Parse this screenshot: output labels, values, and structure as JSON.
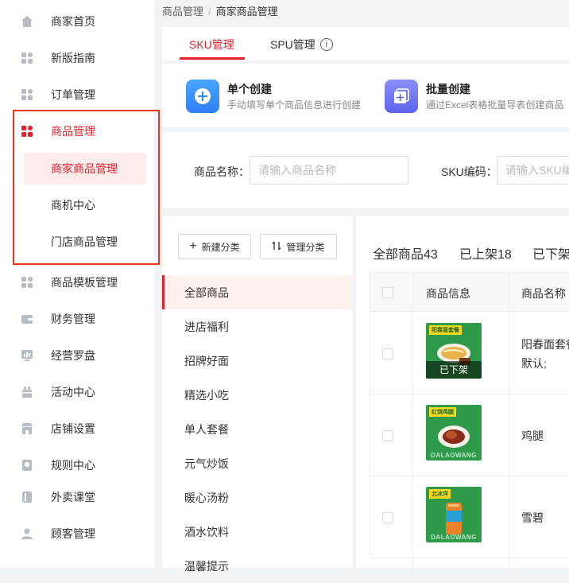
{
  "sidebar": {
    "items": [
      {
        "label": "商家首页",
        "icon": "home-icon"
      },
      {
        "label": "新版指南",
        "icon": "grid-icon"
      },
      {
        "label": "订单管理",
        "icon": "grid-icon"
      },
      {
        "label": "商品管理",
        "icon": "grid-icon",
        "active": true
      },
      {
        "label": "商品模板管理",
        "icon": "grid-icon"
      },
      {
        "label": "财务管理",
        "icon": "wallet-icon"
      },
      {
        "label": "经营罗盘",
        "icon": "chart-icon"
      },
      {
        "label": "活动中心",
        "icon": "gift-icon"
      },
      {
        "label": "店铺设置",
        "icon": "store-icon"
      },
      {
        "label": "规则中心",
        "icon": "rule-icon"
      },
      {
        "label": "外卖课堂",
        "icon": "book-icon"
      },
      {
        "label": "顾客管理",
        "icon": "user-icon"
      }
    ],
    "subitems": [
      {
        "label": "商家商品管理",
        "selected": true
      },
      {
        "label": "商机中心"
      },
      {
        "label": "门店商品管理"
      }
    ]
  },
  "breadcrumb": {
    "parent": "商品管理",
    "separator": "/",
    "current": "商家商品管理"
  },
  "tabs": {
    "sku": "SKU管理",
    "spu": "SPU管理",
    "info": "i"
  },
  "create": {
    "single_title": "单个创建",
    "single_desc": "手动填写单个商品信息进行创建",
    "batch_title": "批量创建",
    "batch_desc": "通过Excel表格批量导表创建商品"
  },
  "filter": {
    "name_label": "商品名称：",
    "name_placeholder": "请输入商品名称",
    "sku_label": "SKU编码：",
    "sku_placeholder": "请输入SKU编码"
  },
  "category": {
    "new_btn": "新建分类",
    "manage_btn": "管理分类",
    "items": [
      "全部商品",
      "进店福利",
      "招牌好面",
      "精选小吃",
      "单人套餐",
      "元气炒饭",
      "暖心汤粉",
      "酒水饮料",
      "温馨提示"
    ]
  },
  "products": {
    "stats": {
      "all": "全部商品43",
      "on": "已上架18",
      "off": "已下架"
    },
    "headers": {
      "info": "商品信息",
      "name": "商品名称"
    },
    "rows": [
      {
        "name": "阳春面套餐",
        "sub": "默认;",
        "badge": "已下架",
        "brand": "阳春面套餐",
        "watermark": ""
      },
      {
        "name": "鸡腿",
        "brand": "红烧鸡腿",
        "watermark": "DALAOWANG"
      },
      {
        "name": "雪碧",
        "brand": "北冰洋",
        "watermark": "DALAOWANG"
      }
    ]
  },
  "colors": {
    "accent": "#e8202a",
    "highlight_box": "#e8361e",
    "blue_icon": "#2f8cf5",
    "purple_icon": "#6b72f2"
  }
}
